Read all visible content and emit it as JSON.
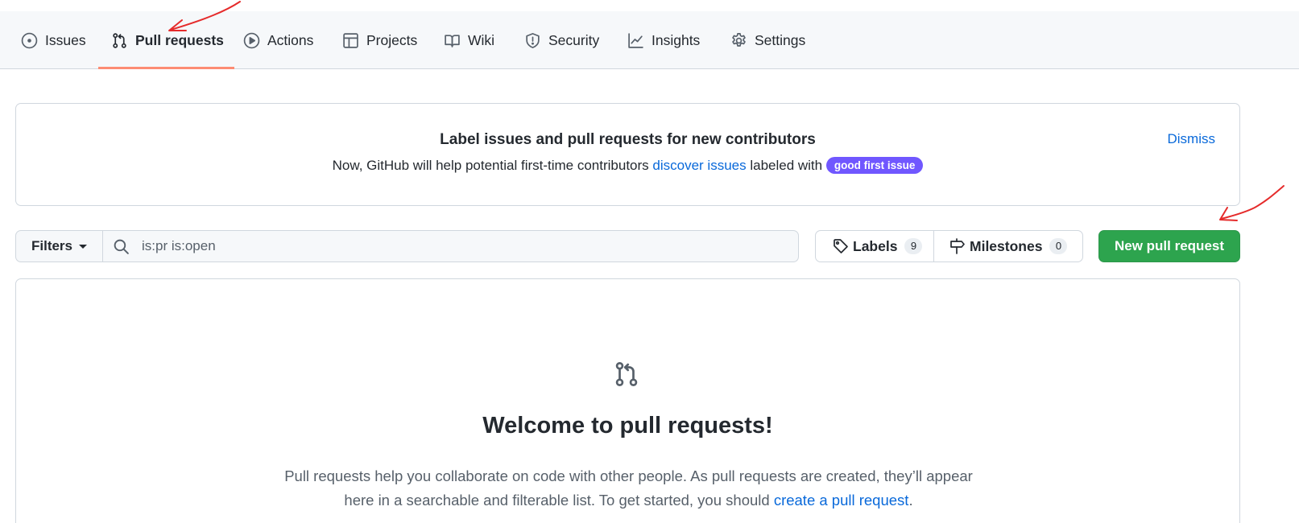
{
  "tabs": [
    {
      "key": "issues",
      "label": "Issues"
    },
    {
      "key": "pulls",
      "label": "Pull requests"
    },
    {
      "key": "actions",
      "label": "Actions"
    },
    {
      "key": "projects",
      "label": "Projects"
    },
    {
      "key": "wiki",
      "label": "Wiki"
    },
    {
      "key": "security",
      "label": "Security"
    },
    {
      "key": "insights",
      "label": "Insights"
    },
    {
      "key": "settings",
      "label": "Settings"
    }
  ],
  "selected_tab": "pulls",
  "banner": {
    "title": "Label issues and pull requests for new contributors",
    "text_before": "Now, GitHub will help potential first-time contributors ",
    "link_text": "discover issues",
    "text_after": " labeled with ",
    "label": "good first issue",
    "label_color": "#7057ff",
    "dismiss": "Dismiss"
  },
  "toolbar": {
    "filters_label": "Filters",
    "search_value": "is:pr is:open",
    "labels_label": "Labels",
    "labels_count": "9",
    "milestones_label": "Milestones",
    "milestones_count": "0",
    "new_pr_label": "New pull request",
    "new_pr_color": "#2da44e"
  },
  "blankslate": {
    "icon": "git-pull-request-icon",
    "title": "Welcome to pull requests!",
    "text": "Pull requests help you collaborate on code with other people. As pull requests are created, they’ll appear here in a searchable and filterable list. To get started, you should ",
    "link_text": "create a pull request",
    "text_end": "."
  },
  "annotation_color": "#e52b2b"
}
